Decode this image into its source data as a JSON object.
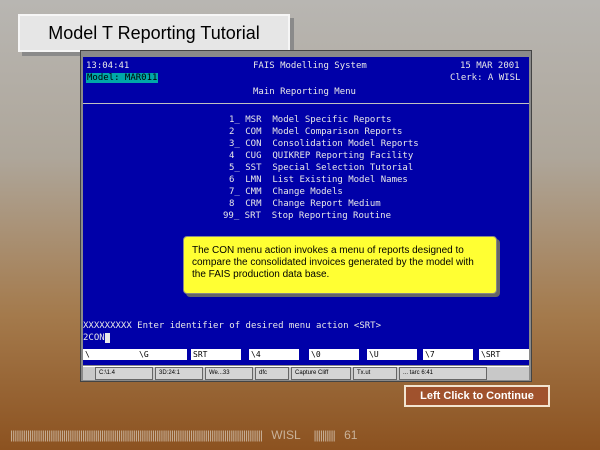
{
  "slide_title": "Model T Reporting Tutorial",
  "terminal": {
    "time": "13:04:41",
    "system_title": "FAIS Modelling System",
    "date": "15 MAR 2001",
    "model_label": "Model: MAR011",
    "clerk": "Clerk: A WISL",
    "menu_title": "Main Reporting Menu",
    "menu_items": [
      {
        "code": "1_ MSR",
        "label": "Model Specific Reports"
      },
      {
        "code": "2  COM",
        "label": "Model Comparison Reports"
      },
      {
        "code": "3_ CON",
        "label": "Consolidation Model Reports"
      },
      {
        "code": "4  CUG",
        "label": "QUIKREP Reporting Facility"
      },
      {
        "code": "5_ SST",
        "label": "Special Selection Tutorial"
      },
      {
        "code": "6  LMN",
        "label": "List Existing Model Names"
      },
      {
        "code": "7_ CMM",
        "label": "Change Models"
      },
      {
        "code": "8  CRM",
        "label": "Change Report Medium"
      },
      {
        "code": "99_ SRT",
        "label": "Stop Reporting Routine"
      }
    ],
    "prompt": "XXXXXXXXX Enter identifier of desired menu action <SRT>",
    "input_value": "2CON",
    "function_keys": [
      "\\",
      "\\G",
      "SRT",
      "\\4",
      "\\0",
      "\\U",
      "\\7",
      "\\SRT"
    ]
  },
  "callout_text": "The CON menu action invokes a menu of reports designed to compare the consolidated invoices generated by the model with the FAIS production data base.",
  "taskbar_items": [
    "C:\\1.4",
    "3D:24:1",
    "We...33",
    "dfc",
    "Capture Cliff",
    "Tx.ut",
    "... tarc 6:41"
  ],
  "continue_button": "Left Click to Continue",
  "footer": {
    "org": "WISL",
    "page_number": "61"
  }
}
